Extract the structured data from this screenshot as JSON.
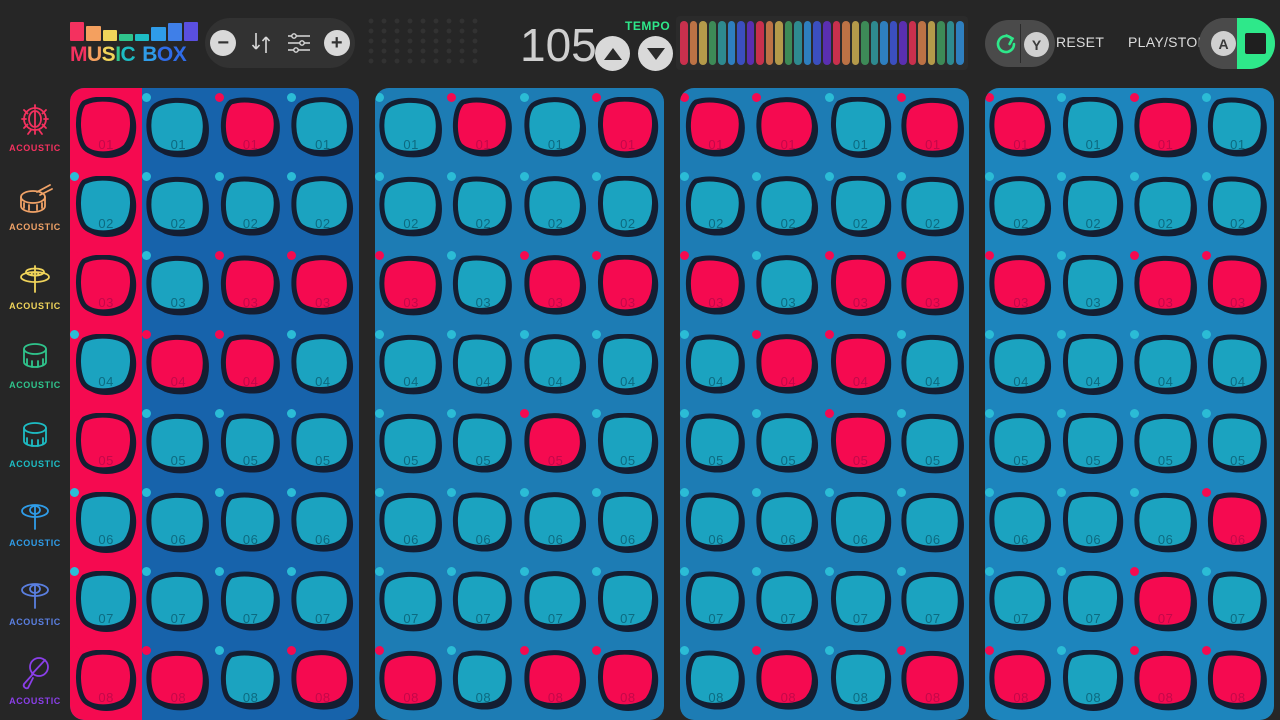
{
  "app": {
    "title": "MUSIC BOX",
    "logo_letters": [
      {
        "ch": "M",
        "color": "#f4315f"
      },
      {
        "ch": "U",
        "color": "#f4a05f"
      },
      {
        "ch": "S",
        "color": "#f0d45a"
      },
      {
        "ch": "I",
        "color": "#2fc48c"
      },
      {
        "ch": "C",
        "color": "#1dbcc4"
      },
      {
        "ch": "B",
        "color": "#2f9ce8"
      },
      {
        "ch": "O",
        "color": "#2f6ce8"
      },
      {
        "ch": "X",
        "color": "#2f6ce8"
      }
    ],
    "logo_bars": [
      {
        "color": "#f4315f",
        "height": 19
      },
      {
        "color": "#f4a05f",
        "height": 15
      },
      {
        "color": "#f0d45a",
        "height": 11
      },
      {
        "color": "#2fc48c",
        "height": 7
      },
      {
        "color": "#1dbcc4",
        "height": 7
      },
      {
        "color": "#2f9ce8",
        "height": 14
      },
      {
        "color": "#3f7fe8",
        "height": 18
      },
      {
        "color": "#5a4fe0",
        "height": 19
      }
    ]
  },
  "toolbar": {
    "minus_label": "−",
    "plus_label": "+",
    "sort_icon": "sort-arrows-icon",
    "settings_icon": "sliders-icon",
    "grille_icon": "speaker-grille"
  },
  "tempo": {
    "value": "105",
    "label": "TEMPO",
    "up_label": "increase-tempo",
    "down_label": "decrease-tempo",
    "accent_color": "#2ee88a"
  },
  "color_strip": {
    "colors": [
      "#c9304d",
      "#bc7245",
      "#b49a4a",
      "#3d8a57",
      "#2e8a8f",
      "#2e7fbf",
      "#3b4fbf",
      "#5a2fb0",
      "#c9304d",
      "#bc7245",
      "#b49a4a",
      "#3d8a57",
      "#2e8a8f",
      "#2e7fbf",
      "#3b4fbf",
      "#5a2fb0",
      "#c9304d",
      "#bc7245",
      "#b49a4a",
      "#3d8a57",
      "#2e8a8f",
      "#2e7fbf",
      "#3b4fbf",
      "#5a2fb0",
      "#c9304d",
      "#bc7245",
      "#b49a4a",
      "#3d8a57",
      "#2e8a8f",
      "#2e7fbf"
    ]
  },
  "transport": {
    "reset_label": "RESET",
    "reset_icon": "refresh-icon",
    "reset_button_letter": "Y",
    "play_stop_label": "PLAY/STOP",
    "play_button_letter": "A",
    "stop_icon": "stop-square-icon",
    "active_color": "#2ee88a"
  },
  "sidebar": {
    "items": [
      {
        "label": "ACOUSTIC",
        "color": "#f4315f",
        "icon": "kick-drum-icon"
      },
      {
        "label": "ACOUSTIC",
        "color": "#f0a267",
        "icon": "snare-drum-icon"
      },
      {
        "label": "ACOUSTIC",
        "color": "#f0d45a",
        "icon": "hihat-cymbal-icon"
      },
      {
        "label": "ACOUSTIC",
        "color": "#2fc48c",
        "icon": "floor-tom-icon"
      },
      {
        "label": "ACOUSTIC",
        "color": "#1dbcc4",
        "icon": "rack-tom-icon"
      },
      {
        "label": "ACOUSTIC",
        "color": "#2f9ce8",
        "icon": "ride-cymbal-icon"
      },
      {
        "label": "ACOUSTIC",
        "color": "#5a7fe0",
        "icon": "crash-cymbal-icon"
      },
      {
        "label": "ACOUSTIC",
        "color": "#8a3fe8",
        "icon": "maraca-icon"
      }
    ]
  },
  "grid": {
    "row_labels": [
      "01",
      "02",
      "03",
      "04",
      "05",
      "06",
      "07",
      "08"
    ],
    "on_color": "#f50a50",
    "off_color": "#1ba3c0",
    "outline_color": "#141e32",
    "panels": [
      {
        "name": "panel-1",
        "bg": "#1763ab",
        "playhead_column": 0,
        "steps": [
          [
            1,
            0,
            1,
            0
          ],
          [
            0,
            0,
            0,
            0
          ],
          [
            1,
            0,
            1,
            1
          ],
          [
            0,
            1,
            1,
            0
          ],
          [
            1,
            0,
            0,
            0
          ],
          [
            0,
            0,
            0,
            0
          ],
          [
            0,
            0,
            0,
            0
          ],
          [
            1,
            1,
            0,
            1
          ]
        ]
      },
      {
        "name": "panel-2",
        "bg": "#1d7cb4",
        "playhead_column": null,
        "steps": [
          [
            0,
            1,
            0,
            1
          ],
          [
            0,
            0,
            0,
            0
          ],
          [
            1,
            0,
            1,
            1
          ],
          [
            0,
            0,
            0,
            0
          ],
          [
            0,
            0,
            1,
            0
          ],
          [
            0,
            0,
            0,
            0
          ],
          [
            0,
            0,
            0,
            0
          ],
          [
            1,
            0,
            1,
            1
          ]
        ]
      },
      {
        "name": "panel-3",
        "bg": "#1d7cb4",
        "playhead_column": null,
        "steps": [
          [
            1,
            1,
            0,
            1
          ],
          [
            0,
            0,
            0,
            0
          ],
          [
            1,
            0,
            1,
            1
          ],
          [
            0,
            1,
            1,
            0
          ],
          [
            0,
            0,
            1,
            0
          ],
          [
            0,
            0,
            0,
            0
          ],
          [
            0,
            0,
            0,
            0
          ],
          [
            0,
            1,
            0,
            1
          ]
        ]
      },
      {
        "name": "panel-4",
        "bg": "#1d85bd",
        "playhead_column": null,
        "steps": [
          [
            1,
            0,
            1,
            0
          ],
          [
            0,
            0,
            0,
            0
          ],
          [
            1,
            0,
            1,
            1
          ],
          [
            0,
            0,
            0,
            0
          ],
          [
            0,
            0,
            0,
            0
          ],
          [
            0,
            0,
            0,
            1
          ],
          [
            0,
            0,
            1,
            0
          ],
          [
            1,
            0,
            1,
            1
          ]
        ]
      }
    ]
  }
}
